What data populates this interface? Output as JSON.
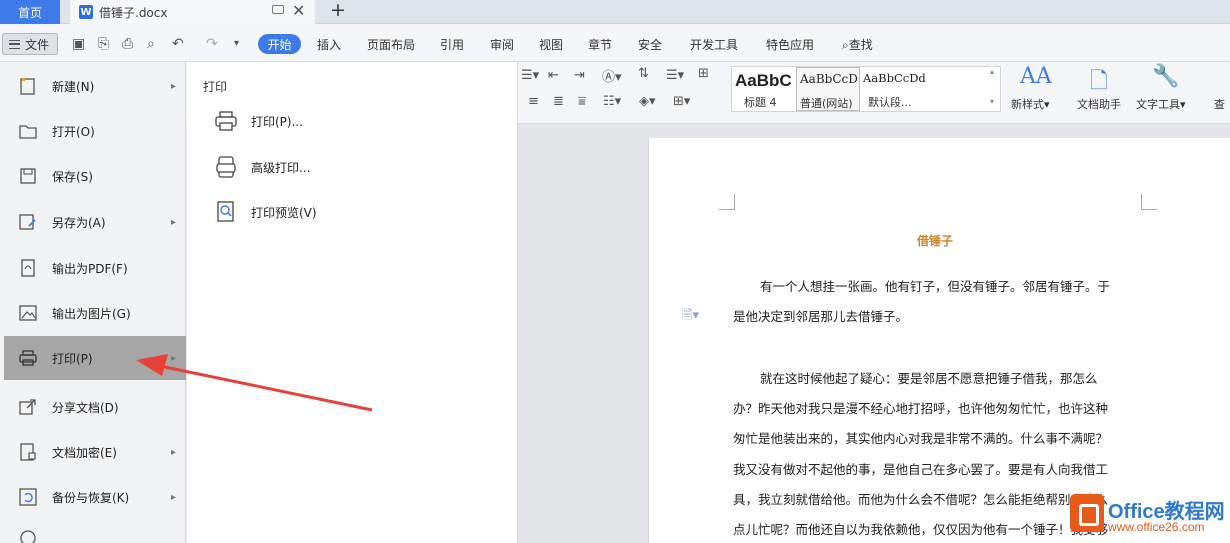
{
  "tabs": {
    "home": "首页",
    "doc_icon": "W",
    "doc_title": "借锤子.docx"
  },
  "menubar": {
    "file": "文件",
    "start": "开始",
    "items": [
      "插入",
      "页面布局",
      "引用",
      "审阅",
      "视图",
      "章节",
      "安全",
      "开发工具",
      "特色应用",
      "查找"
    ]
  },
  "ribbon": {
    "styles": [
      {
        "sample": "AaBbC",
        "name": "标题 4"
      },
      {
        "sample": "AaBbCcD",
        "name": "普通(网站)"
      },
      {
        "sample": "AaBbCcDd",
        "name": "默认段..."
      }
    ],
    "new_style": "新样式",
    "doc_helper": "文档助手",
    "text_tool": "文字工具",
    "cut_label": "查"
  },
  "file_menu": {
    "items": [
      {
        "label": "新建(N)",
        "icon": "new-doc-icon",
        "arrow": true
      },
      {
        "label": "打开(O)",
        "icon": "folder-icon",
        "arrow": false
      },
      {
        "label": "保存(S)",
        "icon": "save-icon",
        "arrow": false
      },
      {
        "label": "另存为(A)",
        "icon": "save-as-icon",
        "arrow": true
      },
      {
        "label": "输出为PDF(F)",
        "icon": "pdf-icon",
        "arrow": false
      },
      {
        "label": "输出为图片(G)",
        "icon": "image-icon",
        "arrow": false
      },
      {
        "label": "打印(P)",
        "icon": "printer-icon",
        "arrow": true,
        "active": true
      },
      {
        "label": "分享文档(D)",
        "icon": "share-icon",
        "arrow": false
      },
      {
        "label": "文档加密(E)",
        "icon": "encrypt-icon",
        "arrow": true
      },
      {
        "label": "备份与恢复(K)",
        "icon": "backup-icon",
        "arrow": true
      }
    ]
  },
  "print_submenu": {
    "header": "打印",
    "items": [
      {
        "label": "打印(P)...",
        "icon": "printer-icon"
      },
      {
        "label": "高级打印...",
        "icon": "advanced-print-icon"
      },
      {
        "label": "打印预览(V)",
        "icon": "print-preview-icon"
      }
    ]
  },
  "document": {
    "title": "借锤子",
    "lines": [
      "有一个人想挂一张画。他有钉子，但没有锤子。邻居有锤子。于",
      "是他决定到邻居那儿去借锤子。",
      "就在这时候他起了疑心：要是邻居不愿意把锤子借我，那怎么",
      "办？昨天他对我只是漫不经心地打招呼，也许他匆匆忙忙，也许这种",
      "匆忙是他装出来的，其实他内心对我是非常不满的。什么事不满呢？",
      "我又没有做对不起他的事，是他自己在多心罢了。要是有人向我借工",
      "具，我立刻就借给他。而他为什么会不借呢？怎么能拒绝帮别人这么",
      "点儿忙呢？而他还自以为我依赖他，仅仅因为他有一个锤子！我受够"
    ]
  },
  "watermark": {
    "brand": "Office教程网",
    "url": "www.office26.com"
  },
  "colors": {
    "accent": "#3e7be9",
    "title_gold": "#c8892a",
    "arrow_red": "#e8403a",
    "watermark_orange": "#e8591a"
  }
}
